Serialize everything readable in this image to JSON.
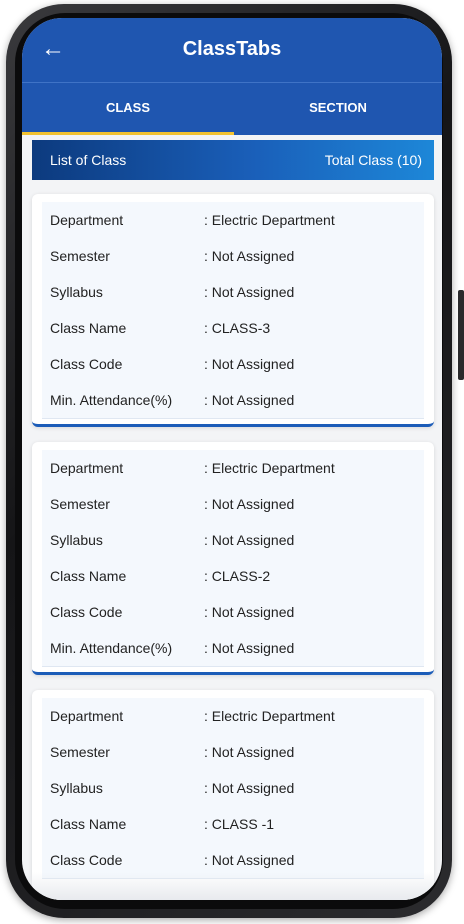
{
  "app": {
    "title": "ClassTabs"
  },
  "tabs": [
    {
      "label": "CLASS",
      "active": true
    },
    {
      "label": "SECTION",
      "active": false
    }
  ],
  "list_header": {
    "title": "List of Class",
    "total": "Total Class (10)"
  },
  "cards": [
    {
      "rows": [
        {
          "label": "Department",
          "value": ": Electric Department"
        },
        {
          "label": "Semester",
          "value": ": Not Assigned"
        },
        {
          "label": "Syllabus",
          "value": ": Not Assigned"
        },
        {
          "label": "Class Name",
          "value": ": CLASS-3"
        },
        {
          "label": "Class Code",
          "value": ": Not Assigned"
        },
        {
          "label": "Min. Attendance(%)",
          "value": ": Not Assigned"
        }
      ]
    },
    {
      "rows": [
        {
          "label": "Department",
          "value": ": Electric Department"
        },
        {
          "label": "Semester",
          "value": ": Not Assigned"
        },
        {
          "label": "Syllabus",
          "value": ": Not Assigned"
        },
        {
          "label": "Class Name",
          "value": ": CLASS-2"
        },
        {
          "label": "Class Code",
          "value": ": Not Assigned"
        },
        {
          "label": "Min. Attendance(%)",
          "value": ": Not Assigned"
        }
      ]
    },
    {
      "rows": [
        {
          "label": "Department",
          "value": ": Electric Department"
        },
        {
          "label": "Semester",
          "value": ": Not Assigned"
        },
        {
          "label": "Syllabus",
          "value": ": Not Assigned"
        },
        {
          "label": "Class Name",
          "value": ": CLASS -1"
        },
        {
          "label": "Class Code",
          "value": ": Not Assigned"
        }
      ]
    }
  ],
  "colors": {
    "appbar": "#1f56b0",
    "tab_indicator": "#f2c230",
    "card_accent": "#1b5cb8"
  }
}
